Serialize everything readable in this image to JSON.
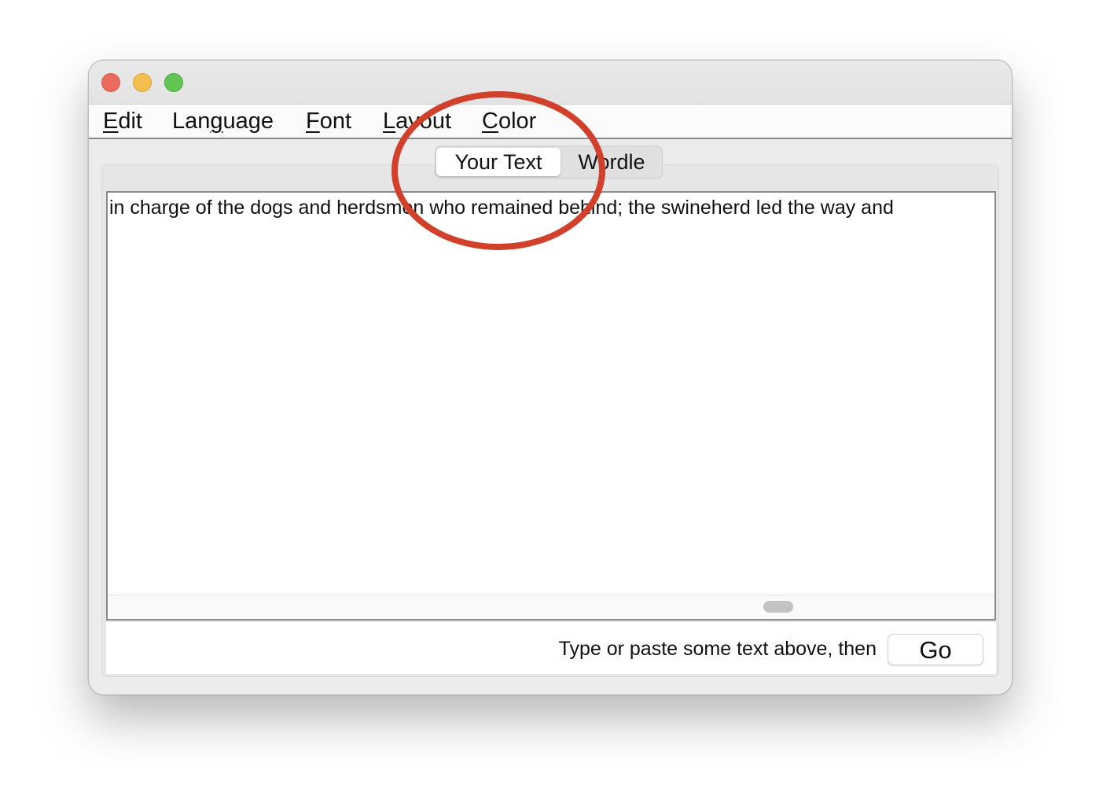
{
  "menubar": {
    "items": [
      {
        "mnemonic": "E",
        "rest": "dit"
      },
      {
        "pre": "Lan",
        "mnemonic": "g",
        "rest": "uage"
      },
      {
        "mnemonic": "F",
        "rest": "ont"
      },
      {
        "mnemonic": "L",
        "rest": "ayout"
      },
      {
        "mnemonic": "C",
        "rest": "olor"
      }
    ]
  },
  "tabs": {
    "active_label": "Your Text",
    "inactive_label": "Wordle"
  },
  "editor": {
    "text": "in charge of the dogs and herdsmen who remained behind; the swineherd led the way and"
  },
  "footer": {
    "hint": "Type or paste some text above, then",
    "go_label": "Go"
  },
  "annotation": {
    "color": "#d0402a"
  }
}
